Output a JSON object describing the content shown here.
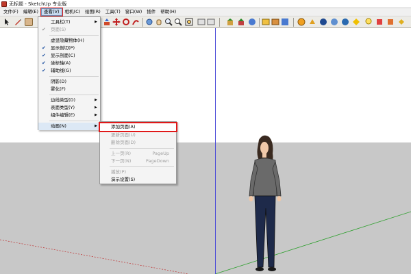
{
  "window": {
    "title": "无标题 - SketchUp 专业版"
  },
  "menubar": {
    "items": [
      "文件(F)",
      "编辑(E)",
      "查看(V)",
      "相机(C)",
      "绘图(R)",
      "工具(T)",
      "窗口(W)",
      "插件",
      "帮助(H)"
    ],
    "active_index": 2
  },
  "view_menu": {
    "items": [
      {
        "label": "工具栏(T)",
        "checked": false,
        "disabled": false,
        "submenu": true
      },
      {
        "label": "页面(S)",
        "checked": true,
        "disabled": true,
        "submenu": false
      },
      {
        "label": "虚显隐藏物体(H)",
        "checked": false,
        "disabled": false,
        "submenu": false
      },
      {
        "label": "显示剖切(P)",
        "checked": true,
        "disabled": false,
        "submenu": false
      },
      {
        "label": "显示剖面(C)",
        "checked": true,
        "disabled": false,
        "submenu": false
      },
      {
        "label": "坐标轴(A)",
        "checked": true,
        "disabled": false,
        "submenu": false
      },
      {
        "label": "辅助线(G)",
        "checked": true,
        "disabled": false,
        "submenu": false
      },
      {
        "label": "阴影(D)",
        "checked": false,
        "disabled": false,
        "submenu": false
      },
      {
        "label": "雾化(F)",
        "checked": false,
        "disabled": false,
        "submenu": false
      },
      {
        "label": "边线类型(D)",
        "checked": false,
        "disabled": false,
        "submenu": true
      },
      {
        "label": "表面类型(Y)",
        "checked": false,
        "disabled": false,
        "submenu": true
      },
      {
        "label": "组件编辑(E)",
        "checked": false,
        "disabled": false,
        "submenu": true
      },
      {
        "label": "动画(N)",
        "checked": false,
        "disabled": false,
        "submenu": true
      }
    ]
  },
  "animation_submenu": {
    "items": [
      {
        "label": "添加页面(A)",
        "accel": "",
        "disabled": false
      },
      {
        "label": "更新页面(U)",
        "accel": "",
        "disabled": true
      },
      {
        "label": "删除页面(D)",
        "accel": "",
        "disabled": true
      },
      {
        "label": "上一页(R)",
        "accel": "PageUp",
        "disabled": true
      },
      {
        "label": "下一页(N)",
        "accel": "PageDown",
        "disabled": true
      },
      {
        "label": "播放(P)",
        "accel": "",
        "disabled": true
      },
      {
        "label": "演示设置(S)",
        "accel": "",
        "disabled": false
      }
    ]
  },
  "icons": {
    "check": "✔",
    "submenu_arrow": "▶"
  },
  "colors": {
    "highlight_outline": "#e01818",
    "blue_axis": "#4b4bd8",
    "green_axis": "#2fa02f",
    "red_axis": "#c04040"
  }
}
